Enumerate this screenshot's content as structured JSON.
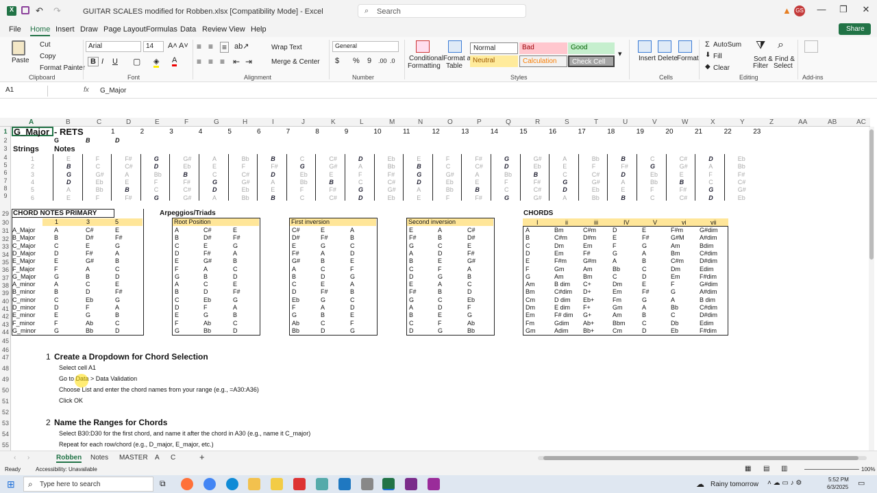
{
  "window": {
    "title": "GUITAR SCALES modified for Robben.xlsx  [Compatibility Mode]  -  Excel",
    "search_placeholder": "Search",
    "user_initials": "GS"
  },
  "menu": [
    "File",
    "Home",
    "Insert",
    "Draw",
    "Page Layout",
    "Formulas",
    "Data",
    "Review",
    "View",
    "Help"
  ],
  "share_label": "Share",
  "ribbon": {
    "paste": "Paste",
    "cut": "Cut",
    "copy": "Copy",
    "format_painter": "Format Painter",
    "font_name": "Arial",
    "font_size": "14",
    "wrap_text": "Wrap Text",
    "merge_center": "Merge & Center",
    "number_format": "General",
    "cond_format": "Conditional",
    "cond_format2": "Formatting",
    "format_as_table": "Format as",
    "format_as_table2": "Table",
    "styles": {
      "normal": "Normal",
      "bad": "Bad",
      "good": "Good",
      "neutral": "Neutral",
      "calculation": "Calculation",
      "check_cell": "Check Cell"
    },
    "insert": "Insert",
    "delete": "Delete",
    "format": "Format",
    "autosum": "AutoSum",
    "fill": "Fill",
    "clear": "Clear",
    "sort_filter": "Sort &",
    "sort_filter2": "Filter",
    "find_select": "Find &",
    "find_select2": "Select",
    "addins": "Add-ins",
    "groups": {
      "clipboard": "Clipboard",
      "font": "Font",
      "alignment": "Alignment",
      "number": "Number",
      "styles": "Styles",
      "cells": "Cells",
      "editing": "Editing",
      "addins": "Add-ins"
    }
  },
  "formula_bar": {
    "name_box": "A1",
    "fx": "fx",
    "value": "G_Major"
  },
  "columns": [
    "A",
    "B",
    "C",
    "D",
    "E",
    "F",
    "G",
    "H",
    "I",
    "J",
    "K",
    "L",
    "M",
    "N",
    "O",
    "P",
    "Q",
    "R",
    "S",
    "T",
    "U",
    "V",
    "W",
    "X",
    "Y",
    "Z",
    "AA",
    "AB",
    "AC"
  ],
  "rows": [
    "1",
    "2",
    "3",
    "4",
    "5",
    "6",
    "7",
    "8",
    "9",
    "29",
    "30",
    "31",
    "32",
    "33",
    "34",
    "35",
    "36",
    "37",
    "38",
    "39",
    "40",
    "41",
    "42",
    "43",
    "44",
    "45",
    "46",
    "47",
    "48",
    "49",
    "50",
    "51",
    "52",
    "53",
    "54",
    "55"
  ],
  "sheet": {
    "a1": "G_Major",
    "b1": "- RETS",
    "fret_numbers": [
      "1",
      "2",
      "3",
      "4",
      "5",
      "6",
      "7",
      "8",
      "9",
      "10",
      "11",
      "12",
      "13",
      "14",
      "15",
      "16",
      "17",
      "18",
      "19",
      "20",
      "21",
      "22",
      "23"
    ],
    "row2": [
      "G",
      "B",
      "D"
    ],
    "strings": "Strings",
    "notes": "Notes",
    "string_nums": [
      "1",
      "2",
      "3",
      "4",
      "5",
      "6"
    ],
    "fret_rows": [
      [
        "E",
        "F",
        "F#",
        "G",
        "G#",
        "A",
        "Bb",
        "B",
        "C",
        "C#",
        "D",
        "Eb",
        "E",
        "F",
        "F#",
        "G",
        "G#",
        "A",
        "Bb",
        "B",
        "C",
        "C#",
        "D",
        "Eb"
      ],
      [
        "B",
        "C",
        "C#",
        "D",
        "Eb",
        "E",
        "F",
        "F#",
        "G",
        "G#",
        "A",
        "Bb",
        "B",
        "C",
        "C#",
        "D",
        "Eb",
        "E",
        "F",
        "F#",
        "G",
        "G#",
        "A",
        "Bb"
      ],
      [
        "G",
        "G#",
        "A",
        "Bb",
        "B",
        "C",
        "C#",
        "D",
        "Eb",
        "E",
        "F",
        "F#",
        "G",
        "G#",
        "A",
        "Bb",
        "B",
        "C",
        "C#",
        "D",
        "Eb",
        "E",
        "F",
        "F#"
      ],
      [
        "D",
        "Eb",
        "E",
        "F",
        "F#",
        "G",
        "G#",
        "A",
        "Bb",
        "B",
        "C",
        "C#",
        "D",
        "Eb",
        "E",
        "F",
        "F#",
        "G",
        "G#",
        "A",
        "Bb",
        "B",
        "C",
        "C#"
      ],
      [
        "A",
        "Bb",
        "B",
        "C",
        "C#",
        "D",
        "Eb",
        "E",
        "F",
        "F#",
        "G",
        "G#",
        "A",
        "Bb",
        "B",
        "C",
        "C#",
        "D",
        "Eb",
        "E",
        "F",
        "F#",
        "G",
        "G#"
      ],
      [
        "E",
        "F",
        "F#",
        "G",
        "G#",
        "A",
        "Bb",
        "B",
        "C",
        "C#",
        "D",
        "Eb",
        "E",
        "F",
        "F#",
        "G",
        "G#",
        "A",
        "Bb",
        "B",
        "C",
        "C#",
        "D",
        "Eb"
      ]
    ],
    "chord_notes_title": "CHORD NOTES PRIMARY",
    "chord_note_hdr": [
      "1",
      "3",
      "5"
    ],
    "chord_notes": [
      [
        "A_Major",
        "A",
        "C#",
        "E"
      ],
      [
        "B_Major",
        "B",
        "D#",
        "F#"
      ],
      [
        "C_Major",
        "C",
        "E",
        "G"
      ],
      [
        "D_Major",
        "D",
        "F#",
        "A"
      ],
      [
        "E_Major",
        "E",
        "G#",
        "B"
      ],
      [
        "F_Major",
        "F",
        "A",
        "C"
      ],
      [
        "G_Major",
        "G",
        "B",
        "D"
      ],
      [
        "A_minor",
        "A",
        "C",
        "E"
      ],
      [
        "B_minor",
        "B",
        "D",
        "F#"
      ],
      [
        "C_minor",
        "C",
        "Eb",
        "G"
      ],
      [
        "D_minor",
        "D",
        "F",
        "A"
      ],
      [
        "E_minor",
        "E",
        "G",
        "B"
      ],
      [
        "F_minor",
        "F",
        "Ab",
        "C"
      ],
      [
        "G_minor",
        "G",
        "Bb",
        "D"
      ]
    ],
    "arpeggio_title": "Arpeggios/Triads",
    "root_title": "Root Position",
    "root": [
      [
        "A",
        "C#",
        "E"
      ],
      [
        "B",
        "D#",
        "F#"
      ],
      [
        "C",
        "E",
        "G"
      ],
      [
        "D",
        "F#",
        "A"
      ],
      [
        "E",
        "G#",
        "B"
      ],
      [
        "F",
        "A",
        "C"
      ],
      [
        "G",
        "B",
        "D"
      ],
      [
        "A",
        "C",
        "E"
      ],
      [
        "B",
        "D",
        "F#"
      ],
      [
        "C",
        "Eb",
        "G"
      ],
      [
        "D",
        "F",
        "A"
      ],
      [
        "E",
        "G",
        "B"
      ],
      [
        "F",
        "Ab",
        "C"
      ],
      [
        "G",
        "Bb",
        "D"
      ]
    ],
    "first_title": "First inversion",
    "first": [
      [
        "C#",
        "E",
        "A"
      ],
      [
        "D#",
        "F#",
        "B"
      ],
      [
        "E",
        "G",
        "C"
      ],
      [
        "F#",
        "A",
        "D"
      ],
      [
        "G#",
        "B",
        "E"
      ],
      [
        "A",
        "C",
        "F"
      ],
      [
        "B",
        "D",
        "G"
      ],
      [
        "C",
        "E",
        "A"
      ],
      [
        "D",
        "F#",
        "B"
      ],
      [
        "Eb",
        "G",
        "C"
      ],
      [
        "F",
        "A",
        "D"
      ],
      [
        "G",
        "B",
        "E"
      ],
      [
        "Ab",
        "C",
        "F"
      ],
      [
        "Bb",
        "D",
        "G"
      ]
    ],
    "second_title": "Second inversion",
    "second": [
      [
        "E",
        "A",
        "C#"
      ],
      [
        "F#",
        "B",
        "D#"
      ],
      [
        "G",
        "C",
        "E"
      ],
      [
        "A",
        "D",
        "F#"
      ],
      [
        "B",
        "E",
        "G#"
      ],
      [
        "C",
        "F",
        "A"
      ],
      [
        "D",
        "G",
        "B"
      ],
      [
        "E",
        "A",
        "C"
      ],
      [
        "F#",
        "B",
        "D"
      ],
      [
        "G",
        "C",
        "Eb"
      ],
      [
        "A",
        "D",
        "F"
      ],
      [
        "B",
        "E",
        "G"
      ],
      [
        "C",
        "F",
        "Ab"
      ],
      [
        "D",
        "G",
        "Bb"
      ]
    ],
    "chords_title": "CHORDS",
    "chords_hdr": [
      "I",
      "ii",
      "iii",
      "IV",
      "V",
      "vi",
      "vii"
    ],
    "chords": [
      [
        "A",
        "Bm",
        "C#m",
        "D",
        "E",
        "F#m",
        "G#dim"
      ],
      [
        "B",
        "C#m",
        "D#m",
        "E",
        "F#",
        "G#M",
        "A#dim"
      ],
      [
        "C",
        "Dm",
        "Em",
        "F",
        "G",
        "Am",
        "Bdim"
      ],
      [
        "D",
        "Em",
        "F#",
        "G",
        "A",
        "Bm",
        "C#dim"
      ],
      [
        "E",
        "F#m",
        "G#m",
        "A",
        "B",
        "C#m",
        "D#dim"
      ],
      [
        "F",
        "Gm",
        "Am",
        "Bb",
        "C",
        "Dm",
        "Edim"
      ],
      [
        "G",
        "Am",
        "Bm",
        "C",
        "D",
        "Em",
        "F#dim"
      ],
      [
        "Am",
        "B dim",
        "C+",
        "Dm",
        "E",
        "F",
        "G#dim"
      ],
      [
        "Bm",
        "C#dim",
        "D+",
        "Em",
        "F#",
        "G",
        "A#dim"
      ],
      [
        "Cm",
        "D dim",
        "Eb+",
        "Fm",
        "G",
        "A",
        "B dim"
      ],
      [
        "Dm",
        "E dim",
        "F+",
        "Gm",
        "A",
        "Bb",
        "C#dim"
      ],
      [
        "Em",
        "F# dim",
        "G+",
        "Am",
        "B",
        "C",
        "D#dim"
      ],
      [
        "Fm",
        "Gdim",
        "Ab+",
        "Bbm",
        "C",
        "Db",
        "Edim"
      ],
      [
        "Gm",
        "Adim",
        "Bb+",
        "Cm",
        "D",
        "Eb",
        "F#dim"
      ]
    ],
    "step1_num": "1",
    "step1": "Create a Dropdown for Chord Selection",
    "step1_lines": [
      "Select cell A1",
      "Go to Data > Data Validation",
      "Choose List and enter the chord names from your range (e.g., =A30:A36)",
      "Click OK"
    ],
    "step2_num": "2",
    "step2": "Name the Ranges for Chords",
    "step2_lines": [
      "Select B30:D30 for the first chord, and name it after the chord in A30 (e.g., name it C_major)",
      "Repeat for each row/chord (e.g., D_major, E_major, etc.)"
    ]
  },
  "sheet_tabs": [
    "Robben",
    "Notes",
    "MASTER",
    "A",
    "C"
  ],
  "status": {
    "ready": "Ready",
    "accessibility": "Accessibility: Unavailable",
    "zoom": "100%"
  },
  "taskbar": {
    "search": "Type here to search",
    "weather": "Rainy tomorrow",
    "time": "5:52 PM",
    "date": "6/3/2025"
  }
}
